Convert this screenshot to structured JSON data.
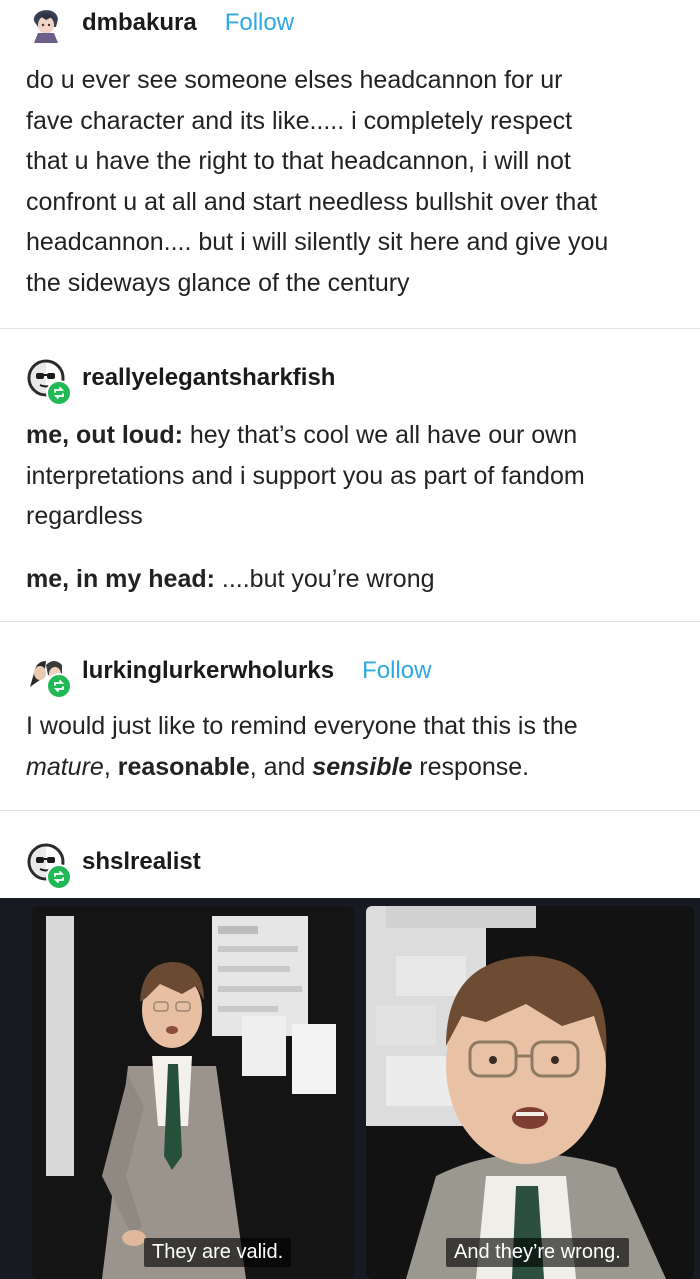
{
  "posts": [
    {
      "username": "dmbakura",
      "follow_label": "Follow",
      "lines": [
        "do u ever see someone elses headcannon for ur",
        "fave character and its like..... i completely respect",
        "that u have the right to that headcannon, i will not",
        "confront u at all and start needless bullshit over that",
        "headcannon.... but i will silently sit here and give you",
        "the sideways glance of the century"
      ]
    },
    {
      "username": "reallyelegantsharkfish",
      "para1_bold": "me, out loud:",
      "para1_lines": [
        " hey that’s cool we all have our own",
        "interpretations and i support you as part of fandom",
        "regardless"
      ],
      "para2_bold": "me, in my head:",
      "para2_rest": " ....but you’re wrong"
    },
    {
      "username": "lurkinglurkerwholurks",
      "follow_label": "Follow",
      "line1": "I would just like to remind everyone that this is the",
      "italic1": "mature",
      "sep1": ", ",
      "bold1": "reasonable",
      "sep2": ", and ",
      "bolditalic": "sensible",
      "end": " response."
    },
    {
      "username": "shslrealist",
      "captions": [
        "They are valid.",
        "And they’re wrong."
      ]
    }
  ],
  "colors": {
    "follow": "#2ea8e6",
    "reblog_badge": "#20b956",
    "divider": "#e2e2e2"
  },
  "icons": [
    "avatar-dmbakura",
    "avatar-sunglasses",
    "reblog-icon",
    "avatar-lurker"
  ]
}
